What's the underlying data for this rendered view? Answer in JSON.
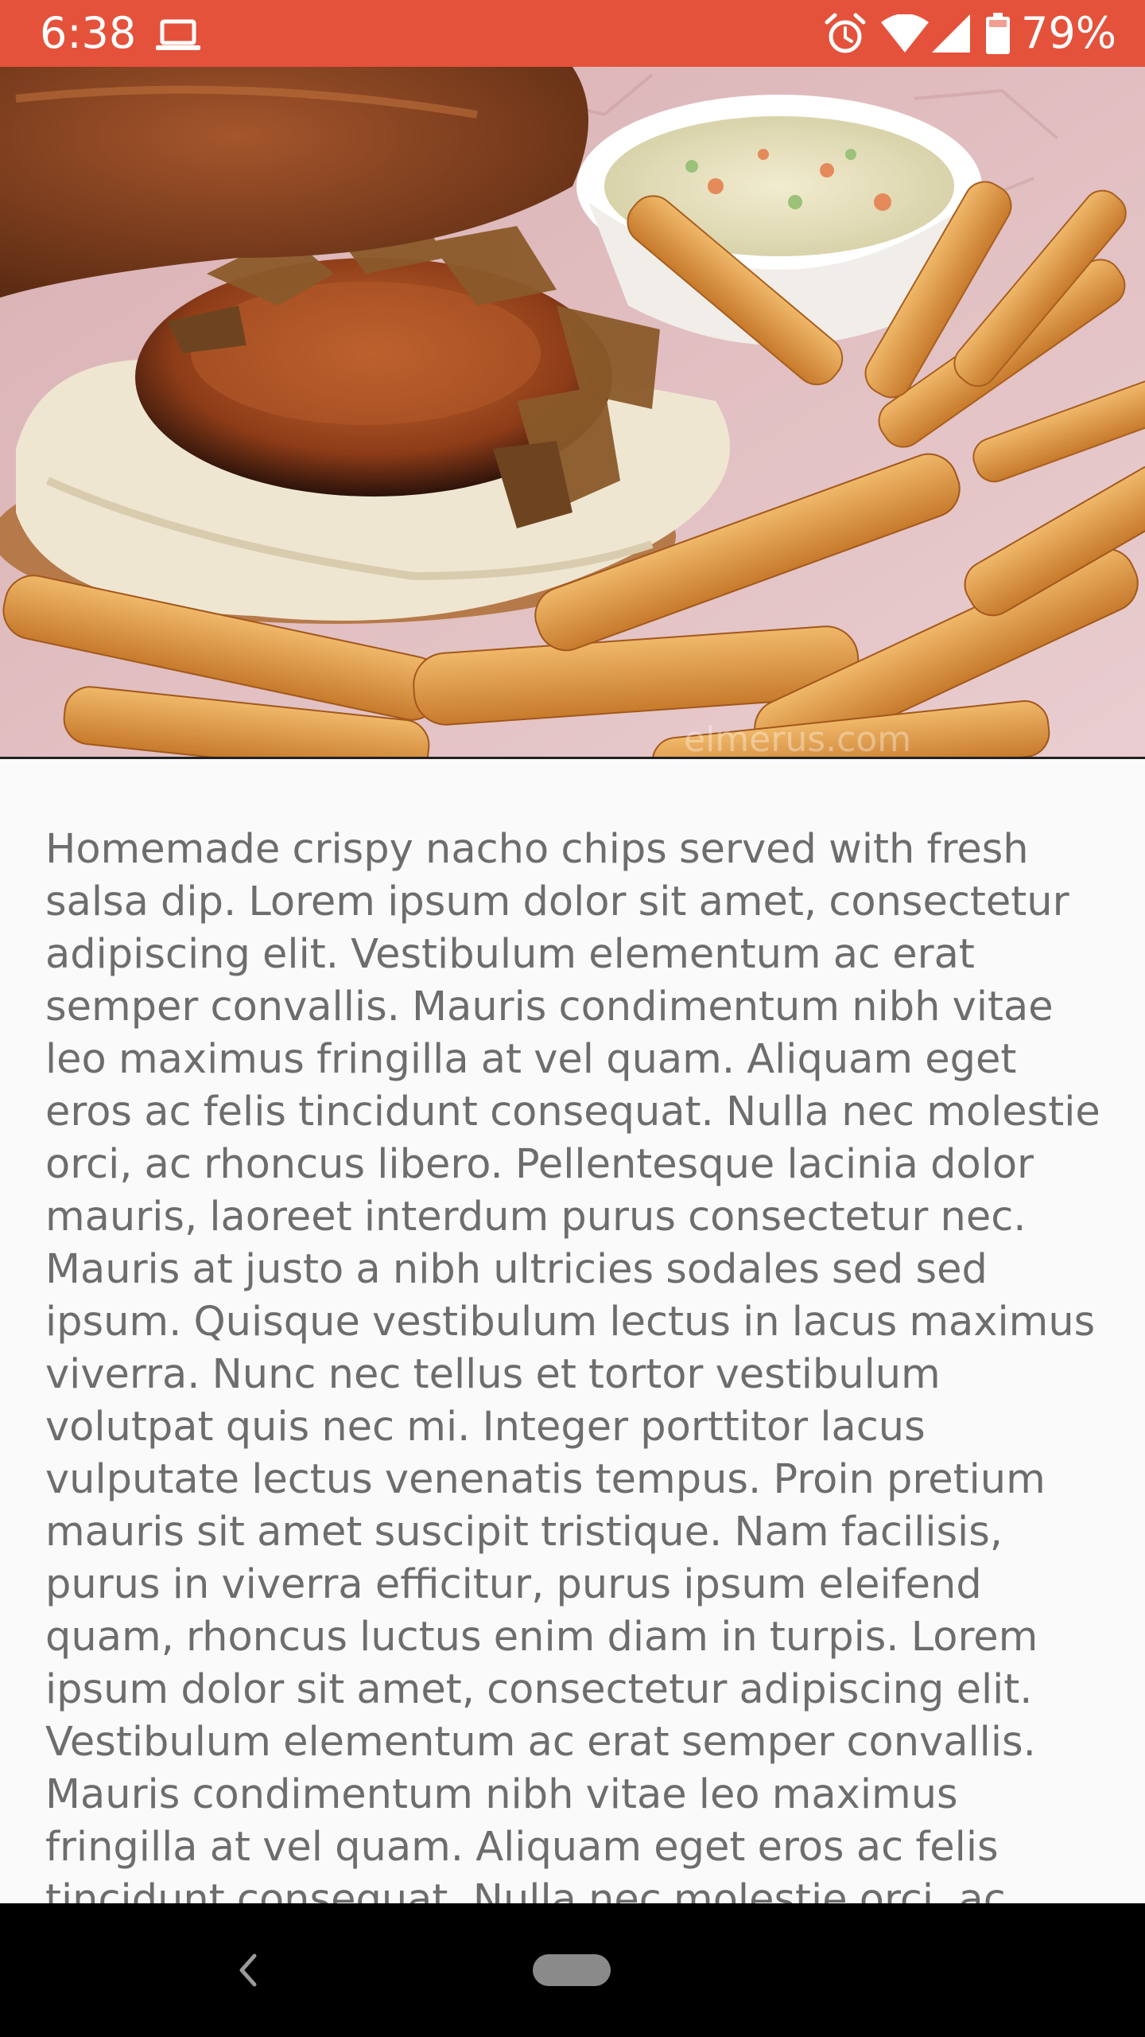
{
  "status_bar": {
    "time": "6:38",
    "battery_percent": "79%",
    "icons": [
      "laptop-icon",
      "alarm-icon",
      "wifi-icon",
      "signal-icon",
      "battery-icon"
    ],
    "background_color": "#e4523b"
  },
  "hero": {
    "alt": "Burger with fries and coleslaw",
    "watermark": "elmerus.com"
  },
  "description": {
    "text": "Homemade crispy nacho chips served with fresh salsa dip. Lorem ipsum dolor sit amet, consectetur adipiscing elit. Vestibulum elementum ac erat semper convallis. Mauris condimentum nibh vitae leo maximus fringilla at vel quam. Aliquam eget eros ac felis tincidunt consequat. Nulla nec molestie orci, ac rhoncus libero. Pellentesque lacinia dolor mauris, laoreet interdum purus consectetur nec. Mauris at justo a nibh ultricies sodales sed sed ipsum. Quisque vestibulum lectus in lacus maximus viverra. Nunc nec tellus et tortor vestibulum volutpat quis nec mi. Integer porttitor lacus vulputate lectus venenatis tempus. Proin pretium mauris sit amet suscipit tristique. Nam facilisis, purus in viverra efficitur, purus ipsum eleifend quam, rhoncus luctus enim diam in turpis. Lorem ipsum dolor sit amet, consectetur adipiscing elit. Vestibulum elementum ac erat semper convallis. Mauris condimentum nibh vitae leo maximus fringilla at vel quam. Aliquam eget eros ac felis tincidunt consequat. Nulla nec molestie orci, ac rhoncus libero. Pellentesque lacinia dolor mauris,"
  },
  "nav_bar": {
    "icons": [
      "back-icon",
      "home-pill-icon"
    ]
  }
}
